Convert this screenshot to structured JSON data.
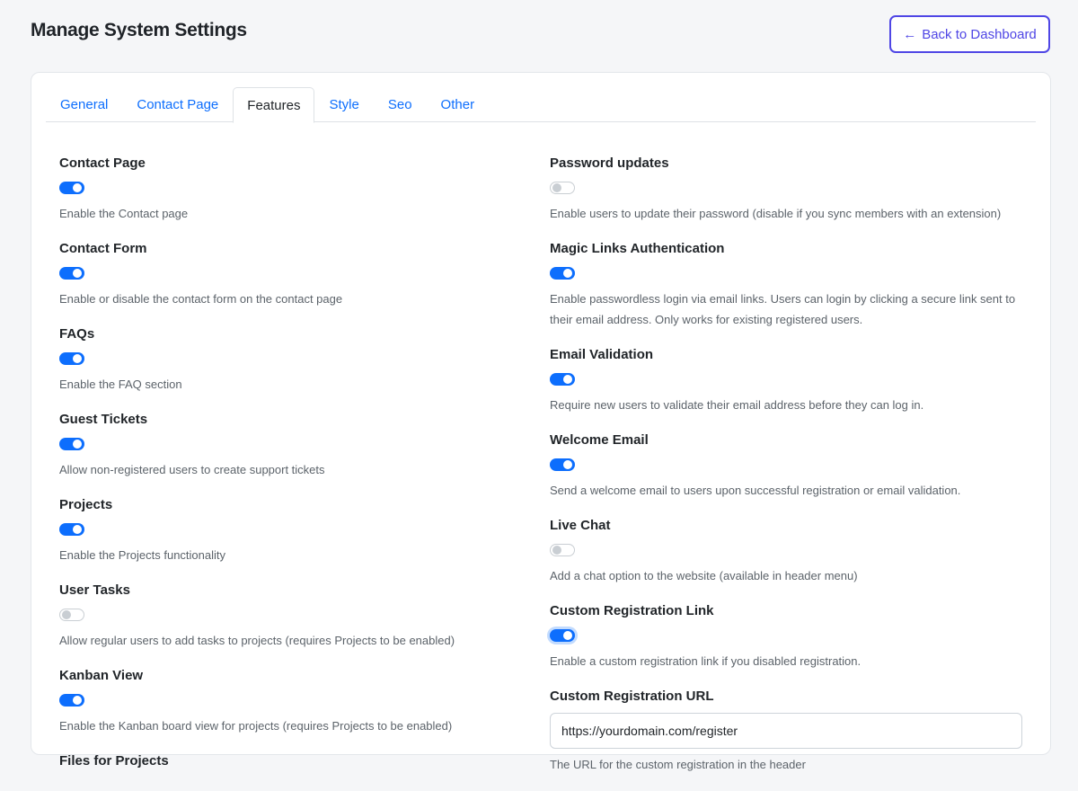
{
  "header": {
    "title": "Manage System Settings",
    "back_label": "Back to Dashboard"
  },
  "tabs": [
    {
      "label": "General",
      "active": false
    },
    {
      "label": "Contact Page",
      "active": false
    },
    {
      "label": "Features",
      "active": true
    },
    {
      "label": "Style",
      "active": false
    },
    {
      "label": "Seo",
      "active": false
    },
    {
      "label": "Other",
      "active": false
    }
  ],
  "left_settings": [
    {
      "label": "Contact Page",
      "enabled": true,
      "description": "Enable the Contact page"
    },
    {
      "label": "Contact Form",
      "enabled": true,
      "description": "Enable or disable the contact form on the contact page"
    },
    {
      "label": "FAQs",
      "enabled": true,
      "description": "Enable the FAQ section"
    },
    {
      "label": "Guest Tickets",
      "enabled": true,
      "description": "Allow non-registered users to create support tickets"
    },
    {
      "label": "Projects",
      "enabled": true,
      "description": "Enable the Projects functionality"
    },
    {
      "label": "User Tasks",
      "enabled": false,
      "description": "Allow regular users to add tasks to projects (requires Projects to be enabled)"
    },
    {
      "label": "Kanban View",
      "enabled": true,
      "description": "Enable the Kanban board view for projects (requires Projects to be enabled)"
    },
    {
      "label": "Files for Projects",
      "enabled": true,
      "description": ""
    }
  ],
  "right_settings": [
    {
      "label": "Password updates",
      "enabled": false,
      "description": "Enable users to update their password (disable if you sync members with an extension)"
    },
    {
      "label": "Magic Links Authentication",
      "enabled": true,
      "description": "Enable passwordless login via email links. Users can login by clicking a secure link sent to their email address. Only works for existing registered users."
    },
    {
      "label": "Email Validation",
      "enabled": true,
      "description": "Require new users to validate their email address before they can log in."
    },
    {
      "label": "Welcome Email",
      "enabled": true,
      "description": "Send a welcome email to users upon successful registration or email validation."
    },
    {
      "label": "Live Chat",
      "enabled": false,
      "description": "Add a chat option to the website (available in header menu)"
    },
    {
      "label": "Custom Registration Link",
      "enabled": true,
      "focused": true,
      "description": "Enable a custom registration link if you disabled registration."
    }
  ],
  "custom_registration_url": {
    "label": "Custom Registration URL",
    "value": "https://yourdomain.com/register",
    "description": "The URL for the custom registration in the header"
  },
  "colors": {
    "accent": "#0d6efd",
    "back_button": "#4f46e5"
  }
}
